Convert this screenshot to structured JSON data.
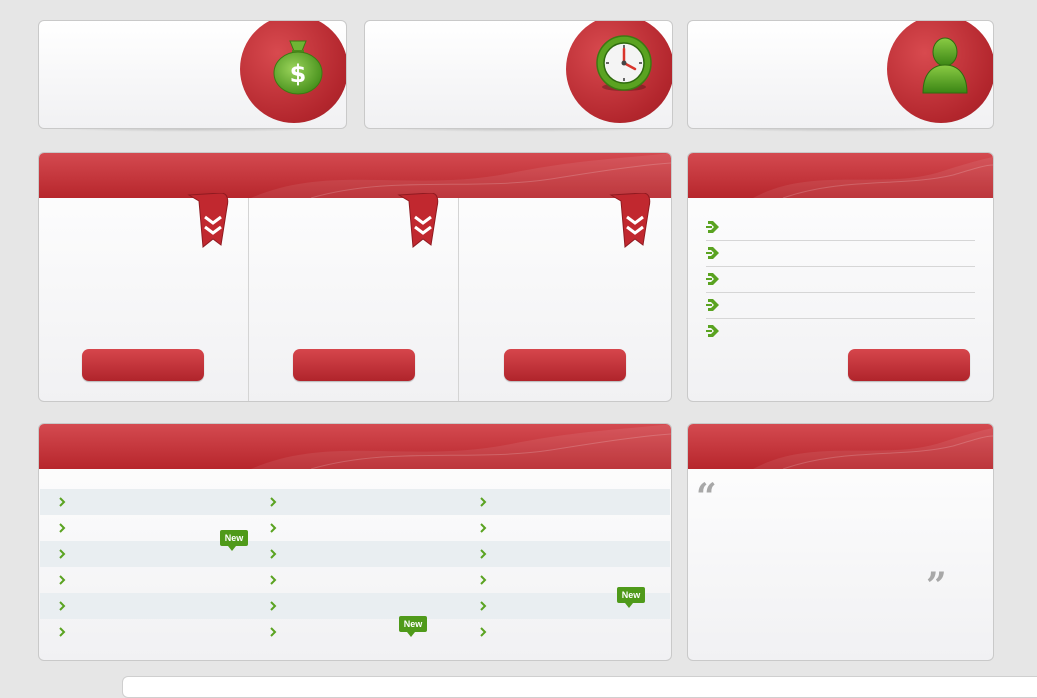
{
  "top_cards": [
    {
      "icon": "money-bag-icon"
    },
    {
      "icon": "clock-icon"
    },
    {
      "icon": "user-icon"
    }
  ],
  "features_panel": {
    "columns": [
      {
        "ribbon": "ribbon-chevron-icon",
        "button_label": ""
      },
      {
        "ribbon": "ribbon-chevron-icon",
        "button_label": ""
      },
      {
        "ribbon": "ribbon-chevron-icon",
        "button_label": ""
      }
    ]
  },
  "side_list_panel": {
    "items": [
      "",
      "",
      "",
      "",
      ""
    ],
    "button_label": ""
  },
  "links_grid": {
    "rows": [
      [
        "",
        "",
        ""
      ],
      [
        "",
        "",
        ""
      ],
      [
        "",
        "",
        ""
      ],
      [
        "",
        "",
        ""
      ],
      [
        "",
        "",
        ""
      ],
      [
        "",
        "",
        ""
      ]
    ],
    "badge_label": "New"
  },
  "testimonial": {
    "open_quote": "“",
    "close_quote": "”",
    "text": ""
  },
  "colors": {
    "accent_red": "#c0323a",
    "accent_green": "#4f9a1a",
    "background": "#e6e6e6"
  }
}
